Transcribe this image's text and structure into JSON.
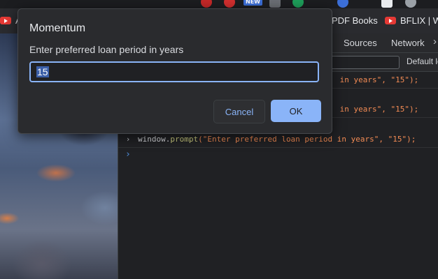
{
  "bookmarks": {
    "item1_label": "A",
    "item2_label": "PDF Books",
    "item3_label": "BFLIX | W"
  },
  "extensions": {
    "new_badge": "NEW"
  },
  "devtools": {
    "tabs": [
      "Sources",
      "Network"
    ],
    "more_icon": "chevron-right-icon",
    "levels_label": "Default le",
    "console": [
      {
        "prefix": "",
        "string_part": " in years\", \"15\");"
      },
      {
        "prefix": "",
        "string_part": " in years\", \"15\");"
      },
      {
        "prefix": "window.",
        "fn": "prompt",
        "string_part": "(\"Enter preferred loan period in years\", \"15\");"
      }
    ],
    "prompt_glyph": "›"
  },
  "dialog": {
    "title": "Momentum",
    "message": "Enter preferred loan period in years",
    "input_value": "15",
    "cancel_label": "Cancel",
    "ok_label": "OK"
  },
  "colors": {
    "accent": "#8ab4f8",
    "string": "#f28b54"
  }
}
